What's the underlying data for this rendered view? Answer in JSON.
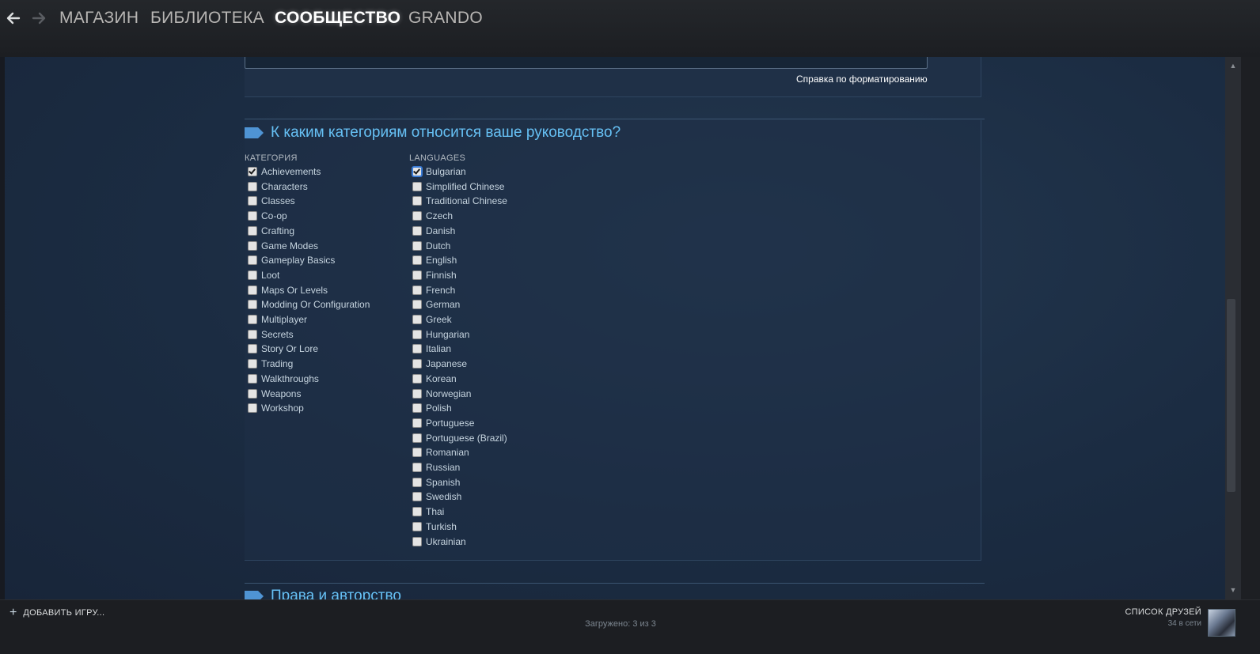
{
  "nav": {
    "back_icon": "arrow-left-icon",
    "forward_icon": "arrow-right-icon",
    "links": [
      {
        "label": "МАГАЗИН",
        "active": false
      },
      {
        "label": "БИБЛИОТЕКА",
        "active": false
      },
      {
        "label": "СООБЩЕСТВО",
        "active": true
      },
      {
        "label": "GRANDO",
        "active": false
      }
    ]
  },
  "editor": {
    "formatting_help": "Справка по форматированию"
  },
  "categories_section": {
    "title": "К каким категориям относится ваше руководство?",
    "category_header": "КАТЕГОРИЯ",
    "languages_header": "LANGUAGES",
    "categories": [
      {
        "label": "Achievements",
        "checked": true
      },
      {
        "label": "Characters",
        "checked": false
      },
      {
        "label": "Classes",
        "checked": false
      },
      {
        "label": "Co-op",
        "checked": false
      },
      {
        "label": "Crafting",
        "checked": false
      },
      {
        "label": "Game Modes",
        "checked": false
      },
      {
        "label": "Gameplay Basics",
        "checked": false
      },
      {
        "label": "Loot",
        "checked": false
      },
      {
        "label": "Maps Or Levels",
        "checked": false
      },
      {
        "label": "Modding Or Configuration",
        "checked": false
      },
      {
        "label": "Multiplayer",
        "checked": false
      },
      {
        "label": "Secrets",
        "checked": false
      },
      {
        "label": "Story Or Lore",
        "checked": false
      },
      {
        "label": "Trading",
        "checked": false
      },
      {
        "label": "Walkthroughs",
        "checked": false
      },
      {
        "label": "Weapons",
        "checked": false
      },
      {
        "label": "Workshop",
        "checked": false
      }
    ],
    "languages": [
      {
        "label": "Bulgarian",
        "checked": true
      },
      {
        "label": "Simplified Chinese",
        "checked": false
      },
      {
        "label": "Traditional Chinese",
        "checked": false
      },
      {
        "label": "Czech",
        "checked": false
      },
      {
        "label": "Danish",
        "checked": false
      },
      {
        "label": "Dutch",
        "checked": false
      },
      {
        "label": "English",
        "checked": false
      },
      {
        "label": "Finnish",
        "checked": false
      },
      {
        "label": "French",
        "checked": false
      },
      {
        "label": "German",
        "checked": false
      },
      {
        "label": "Greek",
        "checked": false
      },
      {
        "label": "Hungarian",
        "checked": false
      },
      {
        "label": "Italian",
        "checked": false
      },
      {
        "label": "Japanese",
        "checked": false
      },
      {
        "label": "Korean",
        "checked": false
      },
      {
        "label": "Norwegian",
        "checked": false
      },
      {
        "label": "Polish",
        "checked": false
      },
      {
        "label": "Portuguese",
        "checked": false
      },
      {
        "label": "Portuguese (Brazil)",
        "checked": false
      },
      {
        "label": "Romanian",
        "checked": false
      },
      {
        "label": "Russian",
        "checked": false
      },
      {
        "label": "Spanish",
        "checked": false
      },
      {
        "label": "Swedish",
        "checked": false
      },
      {
        "label": "Thai",
        "checked": false
      },
      {
        "label": "Turkish",
        "checked": false
      },
      {
        "label": "Ukrainian",
        "checked": false
      }
    ]
  },
  "rights_section": {
    "title": "Права и авторство"
  },
  "bottom": {
    "add_game": "ДОБАВИТЬ ИГРУ...",
    "loaded": "Загружено: 3 из 3",
    "friends_title": "СПИСОК ДРУЗЕЙ",
    "friends_online": "34 в сети"
  },
  "colors": {
    "accent": "#66c0f4",
    "background": "#1b2c42",
    "topbar": "#1c1e22"
  }
}
